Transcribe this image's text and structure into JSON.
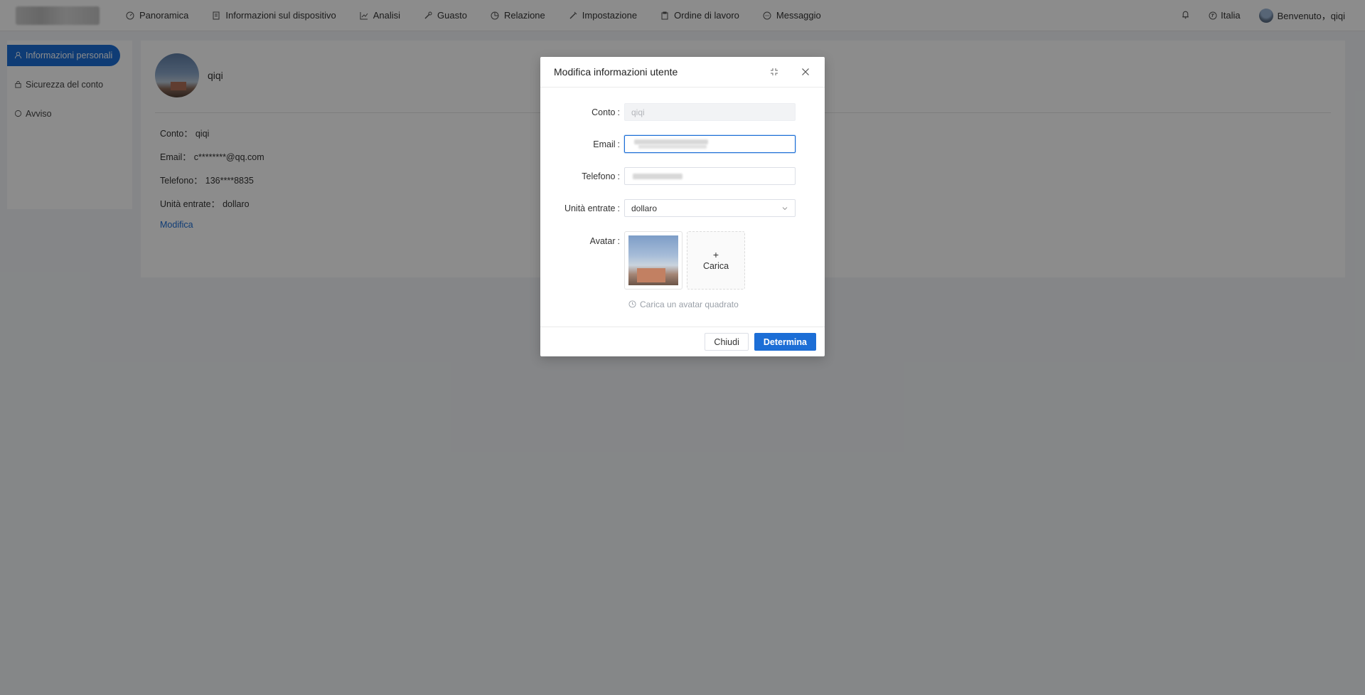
{
  "nav": {
    "items": [
      {
        "label": "Panoramica",
        "icon": "dashboard-icon"
      },
      {
        "label": "Informazioni sul dispositivo",
        "icon": "document-icon"
      },
      {
        "label": "Analisi",
        "icon": "line-chart-icon"
      },
      {
        "label": "Guasto",
        "icon": "wrench-icon"
      },
      {
        "label": "Relazione",
        "icon": "pie-chart-icon"
      },
      {
        "label": "Impostazione",
        "icon": "tool-icon"
      },
      {
        "label": "Ordine di lavoro",
        "icon": "clipboard-icon"
      },
      {
        "label": "Messaggio",
        "icon": "chat-icon"
      }
    ],
    "language": "Italia",
    "welcome": "Benvenuto，qiqi"
  },
  "sidemenu": {
    "items": [
      {
        "label": "Informazioni personali",
        "icon": "user-icon",
        "active": true
      },
      {
        "label": "Sicurezza del conto",
        "icon": "lock-icon",
        "active": false
      },
      {
        "label": "Avviso",
        "icon": "circle-icon",
        "active": false
      }
    ]
  },
  "profile": {
    "name": "qiqi",
    "rows": [
      {
        "label": "Conto：",
        "value": "qiqi"
      },
      {
        "label": "Email：",
        "value": "c********@qq.com"
      },
      {
        "label": "Telefono：",
        "value": "136****8835"
      },
      {
        "label": "Unità entrate：",
        "value": "dollaro"
      }
    ],
    "edit_label": "Modifica"
  },
  "modal": {
    "title": "Modifica informazioni utente",
    "fields": {
      "account_label": "Conto",
      "account_value": "qiqi",
      "email_label": "Email",
      "phone_label": "Telefono",
      "income_label": "Unità entrate",
      "income_value": "dollaro",
      "avatar_label": "Avatar"
    },
    "upload_label": "Carica",
    "hint": "Carica un avatar quadrato",
    "close_label": "Chiudi",
    "confirm_label": "Determina"
  },
  "colors": {
    "primary": "#1c6ed6",
    "overlay": "rgba(0,0,0,0.45)"
  }
}
